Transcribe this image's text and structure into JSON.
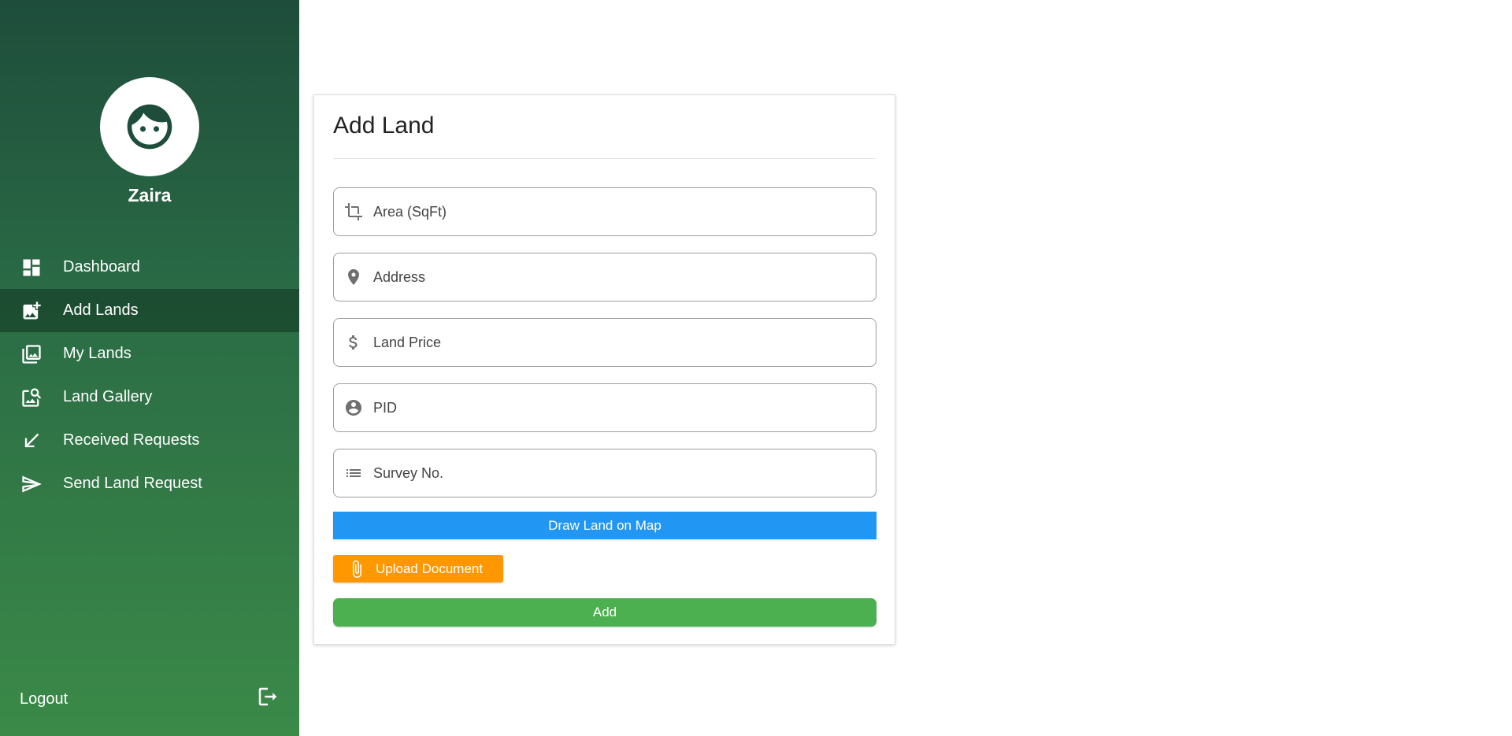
{
  "sidebar": {
    "user": {
      "name": "Zaira",
      "avatar_icon": "face-icon"
    },
    "items": [
      {
        "label": "Dashboard",
        "icon": "dashboard-icon"
      },
      {
        "label": "Add Lands",
        "icon": "add-photo-icon",
        "active": true
      },
      {
        "label": "My Lands",
        "icon": "photo-library-icon"
      },
      {
        "label": "Land Gallery",
        "icon": "image-search-icon"
      },
      {
        "label": "Received Requests",
        "icon": "arrow-down-left-icon"
      },
      {
        "label": "Send Land Request",
        "icon": "send-icon"
      }
    ],
    "logout_label": "Logout"
  },
  "form": {
    "title": "Add Land",
    "fields": [
      {
        "placeholder": "Area (SqFt)",
        "value": "",
        "icon": "ruler-angle-icon"
      },
      {
        "placeholder": "Address",
        "value": "",
        "icon": "location-pin-icon"
      },
      {
        "placeholder": "Land Price",
        "value": "",
        "icon": "dollar-icon"
      },
      {
        "placeholder": "PID",
        "value": "",
        "icon": "account-circle-icon"
      },
      {
        "placeholder": "Survey No.",
        "value": "",
        "icon": "list-icon"
      }
    ],
    "draw_map_label": "Draw Land on Map",
    "upload_label": "Upload Document",
    "add_label": "Add"
  },
  "colors": {
    "sidebar_top": "#1e4d3b",
    "sidebar_bottom": "#3b8a48",
    "map_button": "#2196f3",
    "upload_button": "#ff9800",
    "add_button": "#4caf50"
  }
}
